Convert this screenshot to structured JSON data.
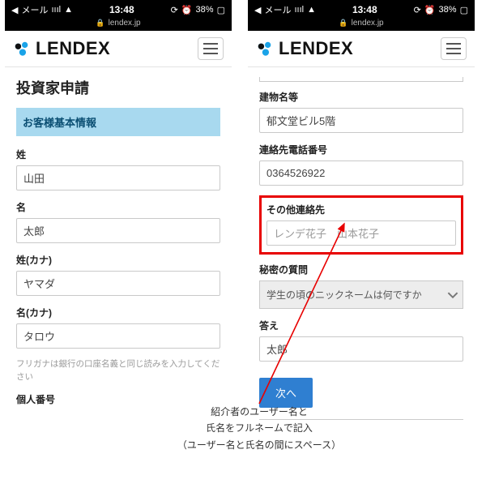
{
  "statusbar": {
    "carrier": "メール",
    "signal": "ıııl",
    "wifi": "᯾",
    "time": "13:48",
    "alarm": "⏰",
    "battery_pct": "38%",
    "battery_icon": "▭"
  },
  "urlbar": {
    "lock": "🔒",
    "domain": "lendex.jp"
  },
  "brand": {
    "name": "LENDEX"
  },
  "left": {
    "page_title": "投資家申請",
    "section_banner": "お客様基本情報",
    "fields": {
      "last_name_label": "姓",
      "last_name_value": "山田",
      "first_name_label": "名",
      "first_name_value": "太郎",
      "last_kana_label": "姓(カナ)",
      "last_kana_value": "ヤマダ",
      "first_kana_label": "名(カナ)",
      "first_kana_value": "タロウ",
      "helper": "フリガナは銀行の口座名義と同じ読みを入力してください",
      "personal_number_heading": "個人番号"
    }
  },
  "right": {
    "fields": {
      "building_label": "建物名等",
      "building_value": "郁文堂ビル5階",
      "phone_label": "連絡先電話番号",
      "phone_value": "0364526922",
      "other_contact_label": "その他連絡先",
      "other_contact_value": "レンデ花子　山本花子",
      "secret_q_label": "秘密の質問",
      "secret_q_value": "学生の頃のニックネームは何ですか",
      "answer_label": "答え",
      "answer_value": "太郎",
      "submit_label": "次へ"
    }
  },
  "annotation": {
    "line1": "紹介者のユーザー名と",
    "line2": "氏名をフルネームで記入",
    "line3": "（ユーザー名と氏名の間にスペース）"
  }
}
